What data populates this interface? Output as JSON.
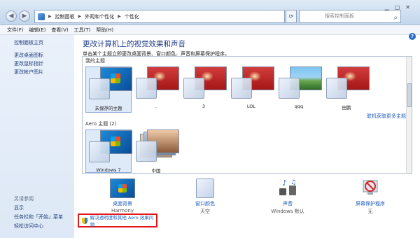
{
  "address": {
    "crumbs": [
      "控制面板",
      "外观和个性化",
      "个性化"
    ],
    "search_placeholder": "搜索控制面板"
  },
  "menu": [
    "文件(F)",
    "编辑(E)",
    "查看(V)",
    "工具(T)",
    "帮助(H)"
  ],
  "left": {
    "home": "控制面板主页",
    "links": [
      "更改桌面图标",
      "更改鼠标指针",
      "更改帐户图片"
    ],
    "see_also_title": "另请参阅",
    "see_also": [
      "显示",
      "任务栏和「开始」菜单",
      "轻松访问中心"
    ]
  },
  "main": {
    "heading": "更改计算机上的视觉效果和声音",
    "subtext": "单击某个主题立即更改桌面背景、窗口颜色、声音和屏幕保护程序。",
    "my_themes_label": "我的主题",
    "my_themes": [
      {
        "name": "未保存的主题",
        "bg": "bg-win"
      },
      {
        "name": ".",
        "bg": "bg-red"
      },
      {
        "name": "3",
        "bg": "bg-red"
      },
      {
        "name": "LOL",
        "bg": "bg-red"
      },
      {
        "name": "qqq",
        "bg": "bg-nature"
      },
      {
        "name": "田鹏",
        "bg": "bg-red"
      }
    ],
    "more_themes_link": "联机获取更多主题",
    "aero_label": "Aero 主题 (2)",
    "aero_themes": [
      {
        "name": "Windows 7"
      },
      {
        "name": "中国"
      }
    ]
  },
  "settings": [
    {
      "label": "桌面背景",
      "value": "Harmony",
      "icon": "desktop-background-icon"
    },
    {
      "label": "窗口颜色",
      "value": "天空",
      "icon": "window-color-icon"
    },
    {
      "label": "声音",
      "value": "Windows 默认",
      "icon": "sound-icon"
    },
    {
      "label": "屏幕保护程序",
      "value": "无",
      "icon": "screensaver-icon"
    }
  ],
  "troubleshoot_link": "解决透明度和其他 Aero 效果问题",
  "colors": {
    "link": "#1f5fbf",
    "heading": "#1c3b8a",
    "highlight_border": "#e01818"
  }
}
